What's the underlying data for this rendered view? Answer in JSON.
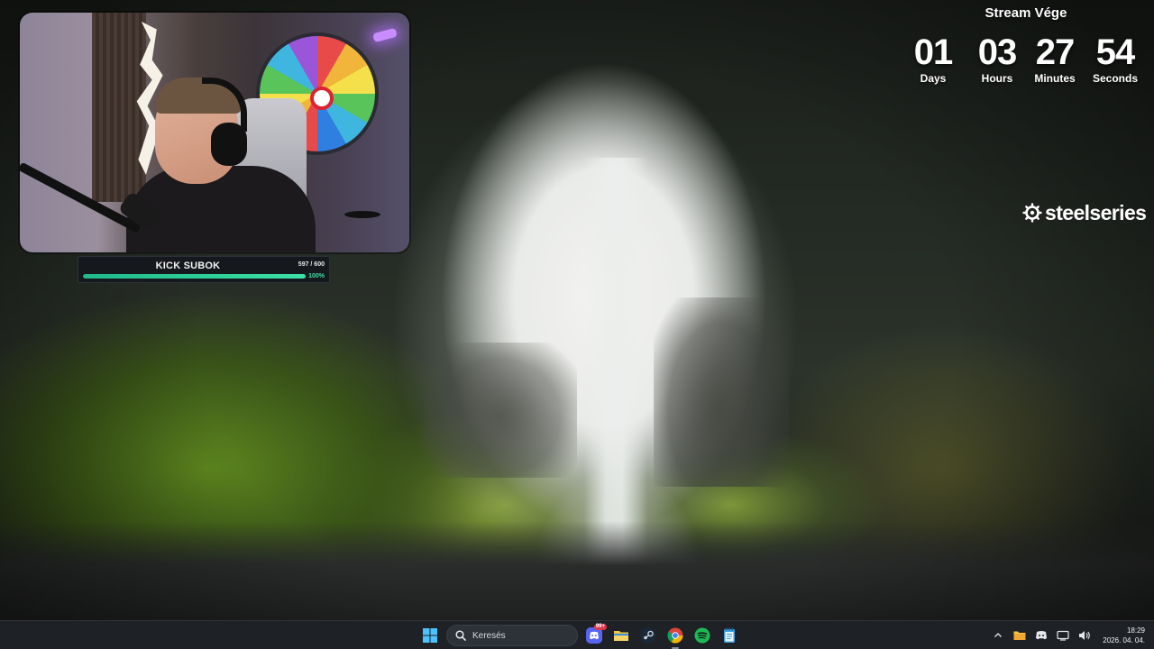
{
  "countdown": {
    "title": "Stream Vége",
    "units": [
      {
        "value": "01",
        "label": "Days"
      },
      {
        "value": "03",
        "label": "Hours"
      },
      {
        "value": "27",
        "label": "Minutes"
      },
      {
        "value": "54",
        "label": "Seconds"
      }
    ]
  },
  "goal": {
    "title": "KICK SUBOK",
    "count": "597 / 600",
    "percent_text": "100%",
    "fill_fraction": 0.995
  },
  "brand": {
    "name": "steelseries"
  },
  "taskbar": {
    "search_label": "Keresés",
    "discord_badge": "99+",
    "apps": [
      "start-icon",
      "search-icon",
      "discord-icon",
      "file-explorer-icon",
      "steam-icon",
      "chrome-icon",
      "spotify-icon",
      "notepad-icon"
    ],
    "tray": [
      "chevron-up-icon",
      "folder-tray-icon",
      "discord-tray-icon",
      "network-icon",
      "volume-icon"
    ],
    "clock_time": "18:29",
    "clock_date": "2026. 04. 04."
  },
  "colors": {
    "goal_fill": "#3de0a6",
    "taskbar_bg": "#1e2227",
    "discord": "#5865f2",
    "steam": "#1b2838",
    "spotify": "#1db954",
    "explorer": "#f4c542"
  }
}
